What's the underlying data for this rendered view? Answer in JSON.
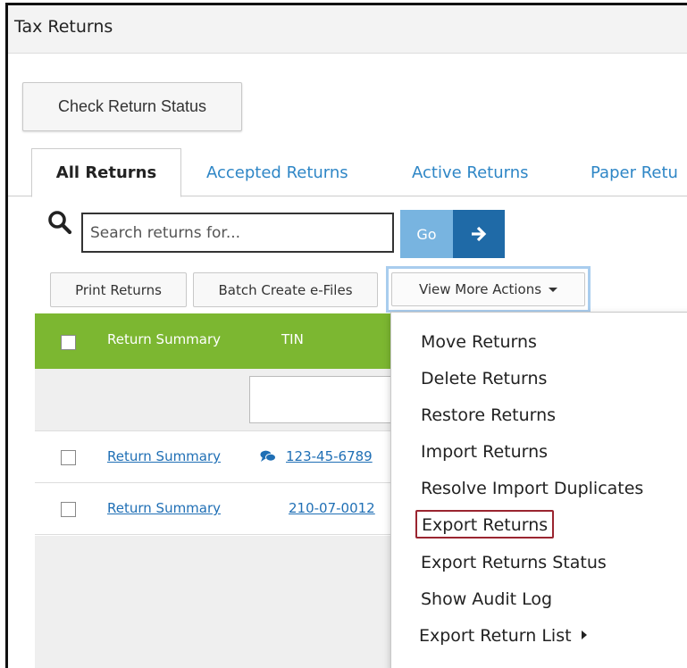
{
  "window": {
    "title": "Tax Returns"
  },
  "actions": {
    "check_status": "Check Return Status"
  },
  "tabs": [
    {
      "label": "All Returns",
      "active": true
    },
    {
      "label": "Accepted Returns",
      "active": false
    },
    {
      "label": "Active Returns",
      "active": false
    },
    {
      "label": "Paper Retu",
      "active": false
    }
  ],
  "search": {
    "placeholder": "Search returns for...",
    "value": "",
    "go_label": "Go"
  },
  "toolbar": {
    "print": "Print Returns",
    "batch": "Batch Create e-Files",
    "view_more": "View More Actions"
  },
  "table": {
    "columns": [
      "Return Summary",
      "TIN"
    ],
    "rows": [
      {
        "summary": "Return Summary",
        "tin": "123-45-6789",
        "has_comment": true
      },
      {
        "summary": "Return Summary",
        "tin": "210-07-0012",
        "has_comment": false
      }
    ]
  },
  "menu": {
    "items": [
      "Move Returns",
      "Delete Returns",
      "Restore Returns",
      "Import Returns",
      "Resolve Import Duplicates",
      "Export Returns",
      "Export Returns Status",
      "Show Audit Log",
      "Export Return List"
    ],
    "highlighted": "Export Returns"
  },
  "icons": {
    "search": "search-icon",
    "arrow": "arrow-right-icon",
    "comment": "comment-icon",
    "caret": "caret-down-icon",
    "submenu": "caret-right-icon"
  },
  "colors": {
    "header_green": "#7cb731",
    "link_blue": "#1f6fb5",
    "go_light": "#78b4e0",
    "go_dark": "#1f6aa7",
    "highlight_red": "#9a2530"
  }
}
